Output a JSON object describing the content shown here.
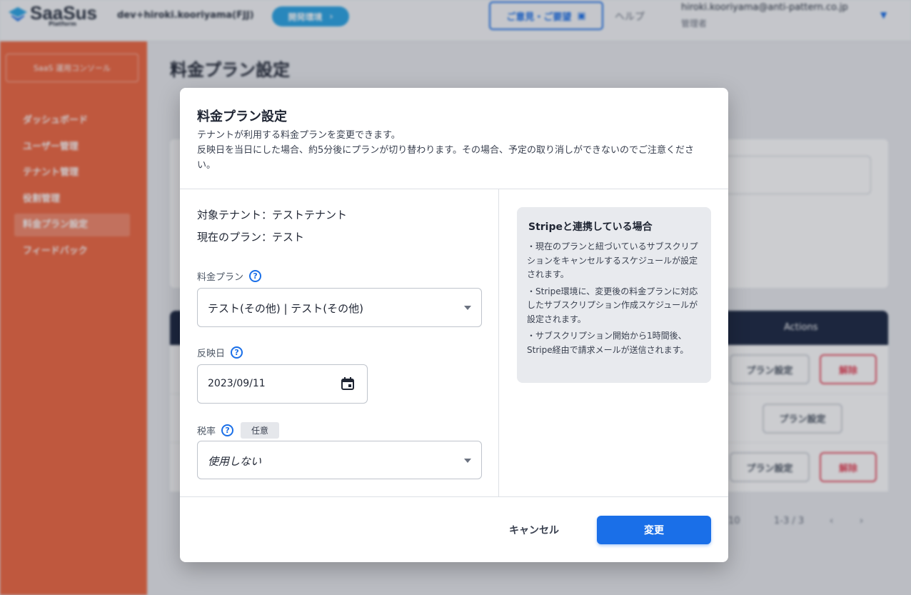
{
  "header": {
    "logo_text": "SaaSus",
    "logo_sub": "Platform",
    "env_user": "dev+hiroki.kooriyama(FJJ)",
    "env_badge": "開発環境",
    "feedback_label": "ご意見・ご要望",
    "help_label": "ヘルプ",
    "account_email": "hiroki.kooriyama@anti-pattern.co.jp",
    "account_role": "管理者"
  },
  "sidebar": {
    "console_label": "SaaS 運用コンソール",
    "items": [
      {
        "label": "ダッシュボード"
      },
      {
        "label": "ユーザー管理"
      },
      {
        "label": "テナント管理"
      },
      {
        "label": "役割管理"
      },
      {
        "label": "料金プラン設定"
      },
      {
        "label": "フィードバック"
      }
    ]
  },
  "main": {
    "title": "料金プラン設定",
    "table": {
      "actions_header": "Actions",
      "plan_button": "プラン設定",
      "delete_button": "解除"
    },
    "pager": {
      "rows_per_page": "10",
      "range": "1-3 / 3"
    }
  },
  "modal": {
    "title": "料金プラン設定",
    "description_line1": "テナントが利用する料金プランを変更できます。",
    "description_line2": "反映日を当日にした場合、約5分後にプランが切り替わります。その場合、予定の取り消しができないのでご注意ください。",
    "target_tenant": "対象テナント：テストテナント",
    "current_plan": "現在のプラン：テスト",
    "plan_field": {
      "label": "料金プラン",
      "value": "テスト(その他) | テスト(その他)"
    },
    "date_field": {
      "label": "反映日",
      "value": "2023/09/11"
    },
    "tax_field": {
      "label": "税率",
      "optional_tag": "任意",
      "value": "使用しない"
    },
    "stripe": {
      "title": "Stripeと連携している場合",
      "notes": [
        "・現在のプランと紐づいているサブスクリプションをキャンセルするスケジュールが設定されます。",
        "・Stripe環境に、変更後の料金プランに対応したサブスクリプション作成スケジュールが設定されます。",
        "・サブスクリプション開始から1時間後、Stripe経由で請求メールが送信されます。"
      ]
    },
    "cancel_label": "キャンセル",
    "submit_label": "変更"
  },
  "colors": {
    "primary": "#1a6fe8",
    "sidebar": "#ef6a45",
    "danger": "#e64b5e",
    "table_header": "#1e2a44"
  }
}
